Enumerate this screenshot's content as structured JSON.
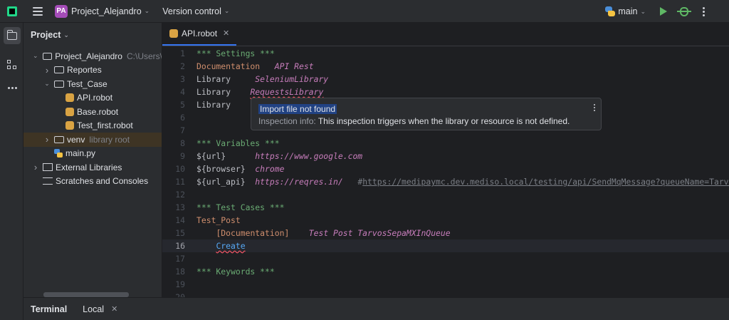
{
  "titlebar": {
    "project_badge": "PA",
    "project_name": "Project_Alejandro",
    "vcs": "Version control",
    "branch": "main"
  },
  "project_panel": {
    "title": "Project",
    "tree": [
      {
        "label": "Project_Alejandro",
        "hint": "C:\\Users\\",
        "icon": "folder-icon",
        "indent": 0,
        "arrow": "down"
      },
      {
        "label": "Reportes",
        "hint": "",
        "icon": "folder-icon",
        "indent": 1,
        "arrow": "right"
      },
      {
        "label": "Test_Case",
        "hint": "",
        "icon": "folder-icon",
        "indent": 1,
        "arrow": "down"
      },
      {
        "label": "API.robot",
        "hint": "",
        "icon": "robot-file-icon",
        "indent": 2,
        "arrow": ""
      },
      {
        "label": "Base.robot",
        "hint": "",
        "icon": "robot-file-icon",
        "indent": 2,
        "arrow": ""
      },
      {
        "label": "Test_first.robot",
        "hint": "",
        "icon": "robot-file-icon",
        "indent": 2,
        "arrow": ""
      },
      {
        "label": "venv",
        "hint": "library root",
        "icon": "folder-icon",
        "indent": 1,
        "arrow": "right"
      },
      {
        "label": "main.py",
        "hint": "",
        "icon": "python-file-icon",
        "indent": 1,
        "arrow": ""
      },
      {
        "label": "External Libraries",
        "hint": "",
        "icon": "library-icon",
        "indent": 0,
        "arrow": "right"
      },
      {
        "label": "Scratches and Consoles",
        "hint": "",
        "icon": "scratches-icon",
        "indent": 0,
        "arrow": ""
      }
    ]
  },
  "editor": {
    "tab_label": "API.robot",
    "lines": [
      {
        "n": "1",
        "parts": [
          [
            "c-sec",
            "*** Settings ***"
          ]
        ]
      },
      {
        "n": "2",
        "parts": [
          [
            "c-set",
            "Documentation   "
          ],
          [
            "c-ital",
            "API Rest"
          ]
        ]
      },
      {
        "n": "3",
        "parts": [
          [
            "c-plain",
            "Library     "
          ],
          [
            "c-ital",
            "SeleniumLibrary"
          ]
        ]
      },
      {
        "n": "4",
        "parts": [
          [
            "c-plain",
            "Library    "
          ],
          [
            "c-ital squig",
            "RequestsLibrary"
          ]
        ]
      },
      {
        "n": "5",
        "parts": [
          [
            "c-plain",
            "Library"
          ]
        ]
      },
      {
        "n": "6",
        "parts": []
      },
      {
        "n": "7",
        "parts": []
      },
      {
        "n": "8",
        "parts": [
          [
            "c-sec",
            "*** Variables ***"
          ]
        ]
      },
      {
        "n": "9",
        "parts": [
          [
            "c-var",
            "${url}      "
          ],
          [
            "c-ital",
            "https://www.google.com"
          ]
        ]
      },
      {
        "n": "10",
        "parts": [
          [
            "c-var",
            "${browser}  "
          ],
          [
            "c-ital",
            "chrome"
          ]
        ]
      },
      {
        "n": "11",
        "parts": [
          [
            "c-var",
            "${url_api}  "
          ],
          [
            "c-ital",
            "https://reqres.in/"
          ],
          [
            "c-cmt",
            "   #"
          ],
          [
            "c-link",
            "https://medipaymc.dev.mediso.local/testing/api/SendMqMessage?queueName=TarvosSepa"
          ]
        ]
      },
      {
        "n": "12",
        "parts": []
      },
      {
        "n": "13",
        "parts": [
          [
            "c-sec",
            "*** Test Cases ***"
          ]
        ]
      },
      {
        "n": "14",
        "parts": [
          [
            "c-set",
            "Test_Post"
          ]
        ]
      },
      {
        "n": "15",
        "parts": [
          [
            "c-plain",
            "    "
          ],
          [
            "c-set",
            "[Documentation]"
          ],
          [
            "c-plain",
            "    "
          ],
          [
            "c-ital",
            "Test Post TarvosSepaMXInQueue"
          ]
        ]
      },
      {
        "n": "16",
        "parts": [
          [
            "c-plain",
            "    "
          ],
          [
            "c-kw squig",
            "Create"
          ]
        ],
        "current": true
      },
      {
        "n": "17",
        "parts": []
      },
      {
        "n": "18",
        "parts": [
          [
            "c-sec",
            "*** Keywords ***"
          ]
        ]
      },
      {
        "n": "19",
        "parts": []
      },
      {
        "n": "20",
        "parts": []
      }
    ]
  },
  "popup": {
    "title": "Import file not found",
    "info_label": "Inspection info:",
    "info_text": " This inspection triggers when the library or resource is not defined."
  },
  "terminal": {
    "title": "Terminal",
    "tab": "Local"
  },
  "colors": {
    "accent": "#3574f0",
    "section": "#6aab73",
    "setting": "#cf8e6d",
    "argument": "#c77dbb",
    "error": "#f75464"
  }
}
